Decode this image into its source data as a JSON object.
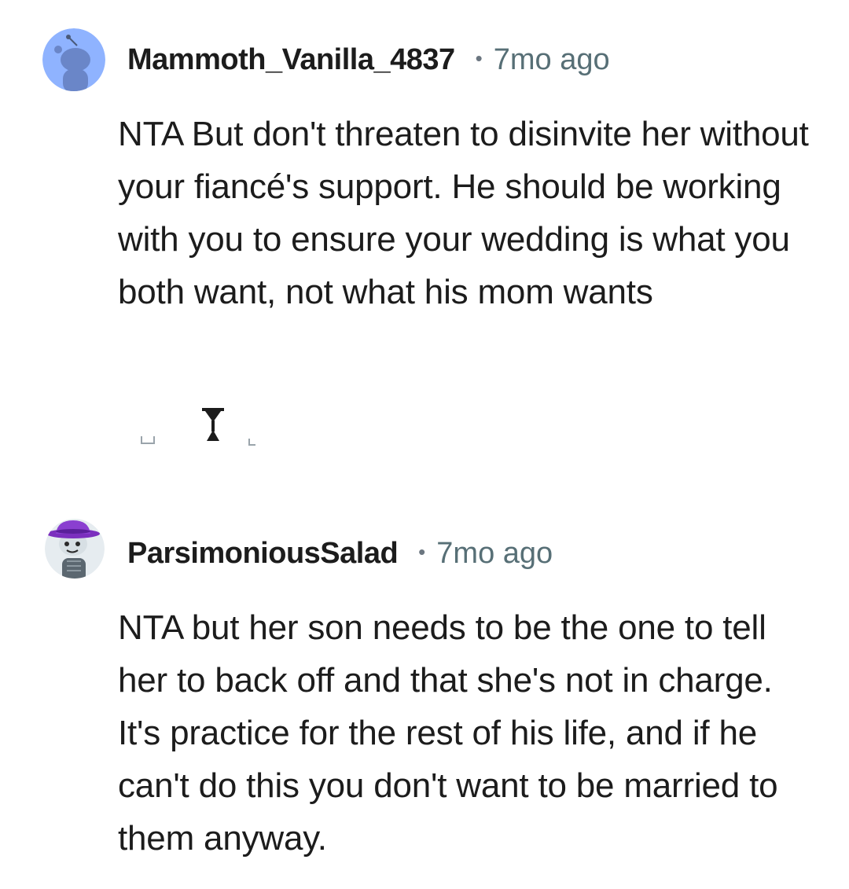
{
  "comments": [
    {
      "avatar": "reddit-snoo-default-avatar",
      "username": "Mammoth_Vanilla_4837",
      "separator": "•",
      "time": "7mo ago",
      "body": "NTA But don't threaten to disinvite her without your fiancé's support. He should be working with you to ensure your wedding is what you both want, not what his mom wants"
    },
    {
      "avatar": "reddit-snoo-purple-hat-avatar",
      "username": "ParsimoniousSalad",
      "separator": "•",
      "time": "7mo ago",
      "body": "NTA but her son needs to be the one to tell her to back off and that she's not in charge. It's practice for the rest of his life, and if he can't do this you don't want to be married to them anyway."
    }
  ],
  "colors": {
    "username": "#1c1c1c",
    "meta": "#576f76",
    "body": "#1c1c1c",
    "avatar1_bg": "#8fb3ff",
    "avatar2_bg": "#e6ecf0",
    "hat": "#7b2fbe"
  }
}
